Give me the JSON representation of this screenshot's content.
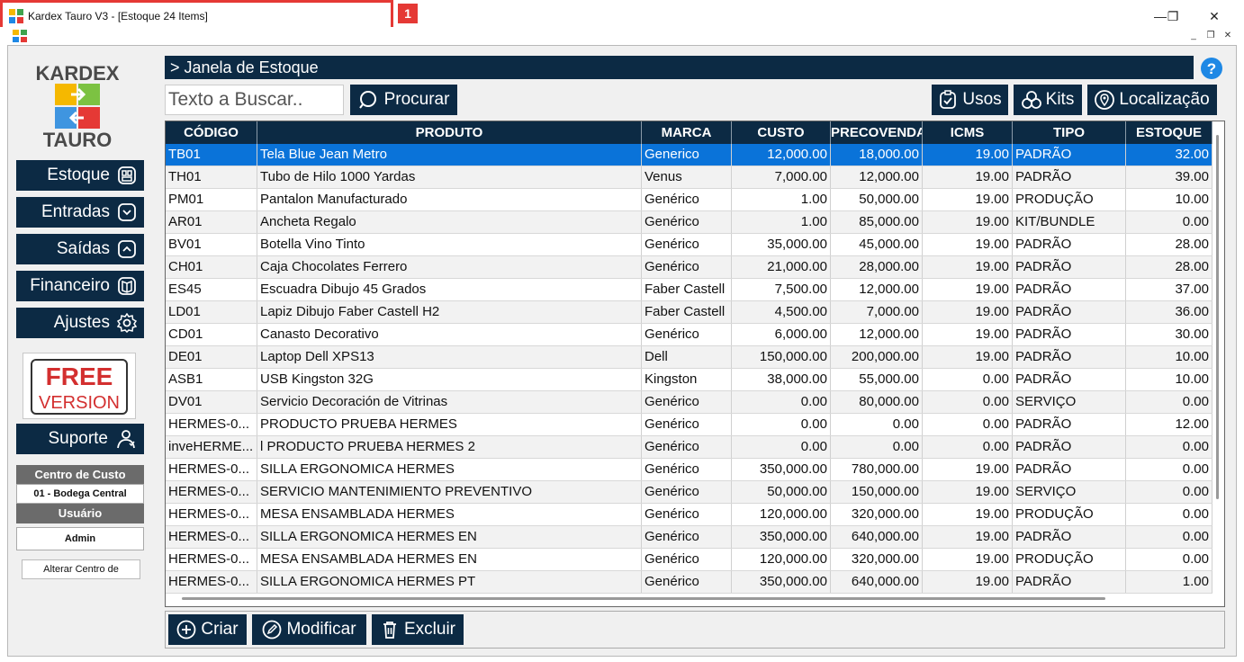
{
  "window": {
    "title": "Kardex Tauro V3 - [Estoque 24 Items]",
    "annotation_number": "1",
    "minimize_glyph": "—",
    "maximize_glyph": "❐",
    "close_glyph": "✕"
  },
  "mdi": {
    "min": "_",
    "restore": "❐",
    "close": "✕"
  },
  "sidebar": {
    "logo_top": "KARDEX",
    "logo_bottom": "TAURO",
    "nav": [
      {
        "label": "Estoque",
        "icon": "box-icon"
      },
      {
        "label": "Entradas",
        "icon": "inbox-in-icon"
      },
      {
        "label": "Saídas",
        "icon": "inbox-out-icon"
      },
      {
        "label": "Financeiro",
        "icon": "book-icon"
      },
      {
        "label": "Ajustes",
        "icon": "gear-icon"
      }
    ],
    "free_line1": "FREE",
    "free_line2": "VERSION",
    "support_label": "Suporte",
    "cost_center_label": "Centro de Custo",
    "cost_center_value": "01 - Bodega Central",
    "user_label": "Usuário",
    "user_value": "Admin",
    "change_cc_label": "Alterar Centro de"
  },
  "content": {
    "header": "> Janela de Estoque",
    "search_placeholder": "Texto a Buscar..",
    "search_button": "Procurar",
    "usos_button": "Usos",
    "kits_button": "Kits",
    "localizacao_button": "Localização",
    "create_button": "Criar",
    "modify_button": "Modificar",
    "delete_button": "Excluir"
  },
  "table": {
    "columns": [
      "CÓDIGO",
      "PRODUTO",
      "MARCA",
      "CUSTO",
      "PRECOVENDA",
      "ICMS",
      "TIPO",
      "ESTOQUE"
    ],
    "rows": [
      [
        "TB01",
        "Tela Blue Jean Metro",
        "Generico",
        "12,000.00",
        "18,000.00",
        "19.00",
        "PADRÃO",
        "32.00"
      ],
      [
        "TH01",
        "Tubo de Hilo 1000 Yardas",
        "Venus",
        "7,000.00",
        "12,000.00",
        "19.00",
        "PADRÃO",
        "39.00"
      ],
      [
        "PM01",
        "Pantalon Manufacturado",
        "Genérico",
        "1.00",
        "50,000.00",
        "19.00",
        "PRODUÇÃO",
        "10.00"
      ],
      [
        "AR01",
        "Ancheta Regalo",
        "Genérico",
        "1.00",
        "85,000.00",
        "19.00",
        "KIT/BUNDLE",
        "0.00"
      ],
      [
        "BV01",
        "Botella Vino Tinto",
        "Genérico",
        "35,000.00",
        "45,000.00",
        "19.00",
        "PADRÃO",
        "28.00"
      ],
      [
        "CH01",
        "Caja Chocolates Ferrero",
        "Genérico",
        "21,000.00",
        "28,000.00",
        "19.00",
        "PADRÃO",
        "28.00"
      ],
      [
        "ES45",
        "Escuadra Dibujo 45 Grados",
        "Faber Castell",
        "7,500.00",
        "12,000.00",
        "19.00",
        "PADRÃO",
        "37.00"
      ],
      [
        "LD01",
        "Lapiz Dibujo Faber Castell H2",
        "Faber Castell",
        "4,500.00",
        "7,000.00",
        "19.00",
        "PADRÃO",
        "36.00"
      ],
      [
        "CD01",
        "Canasto Decorativo",
        "Genérico",
        "6,000.00",
        "12,000.00",
        "19.00",
        "PADRÃO",
        "30.00"
      ],
      [
        "DE01",
        "Laptop Dell XPS13",
        "Dell",
        "150,000.00",
        "200,000.00",
        "19.00",
        "PADRÃO",
        "10.00"
      ],
      [
        "ASB1",
        "USB Kingston 32G",
        "Kingston",
        "38,000.00",
        "55,000.00",
        "0.00",
        "PADRÃO",
        "10.00"
      ],
      [
        "DV01",
        "Servicio Decoración de Vitrinas",
        "Genérico",
        "0.00",
        "80,000.00",
        "0.00",
        "SERVIÇO",
        "0.00"
      ],
      [
        "HERMES-0...",
        "PRODUCTO PRUEBA HERMES",
        "Genérico",
        "0.00",
        "0.00",
        "0.00",
        "PADRÃO",
        "12.00"
      ],
      [
        "inveHERME...",
        "l PRODUCTO PRUEBA HERMES 2",
        "Genérico",
        "0.00",
        "0.00",
        "0.00",
        "PADRÃO",
        "0.00"
      ],
      [
        "HERMES-0...",
        "SILLA ERGONOMICA HERMES",
        "Genérico",
        "350,000.00",
        "780,000.00",
        "19.00",
        "PADRÃO",
        "0.00"
      ],
      [
        "HERMES-0...",
        "SERVICIO MANTENIMIENTO PREVENTIVO",
        "Genérico",
        "50,000.00",
        "150,000.00",
        "19.00",
        "SERVIÇO",
        "0.00"
      ],
      [
        "HERMES-0...",
        "MESA ENSAMBLADA HERMES",
        "Genérico",
        "120,000.00",
        "320,000.00",
        "19.00",
        "PRODUÇÃO",
        "0.00"
      ],
      [
        "HERMES-0...",
        "SILLA ERGONOMICA HERMES EN",
        "Genérico",
        "350,000.00",
        "640,000.00",
        "19.00",
        "PADRÃO",
        "0.00"
      ],
      [
        "HERMES-0...",
        "MESA ENSAMBLADA HERMES EN",
        "Genérico",
        "120,000.00",
        "320,000.00",
        "19.00",
        "PRODUÇÃO",
        "0.00"
      ],
      [
        "HERMES-0...",
        "SILLA ERGONOMICA HERMES PT",
        "Genérico",
        "350,000.00",
        "640,000.00",
        "19.00",
        "PADRÃO",
        "1.00"
      ]
    ],
    "selected_row": 0
  },
  "colors": {
    "navy": "#0c2a44",
    "selection": "#0a73d9",
    "annotation_red": "#e53935",
    "free_red": "#d32f2f"
  }
}
